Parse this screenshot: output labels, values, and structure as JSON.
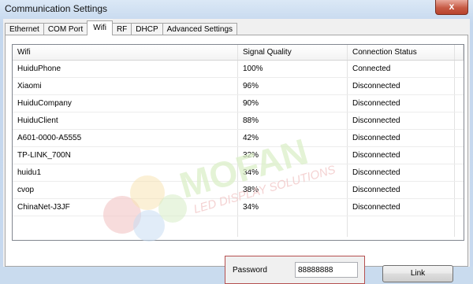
{
  "window": {
    "title": "Communication Settings",
    "close_glyph": "x"
  },
  "tabs": [
    {
      "label": "Ethernet",
      "active": false
    },
    {
      "label": "COM Port",
      "active": false
    },
    {
      "label": "Wifi",
      "active": true
    },
    {
      "label": "RF",
      "active": false
    },
    {
      "label": "DHCP",
      "active": false
    },
    {
      "label": "Advanced Settings",
      "active": false
    }
  ],
  "wifi_table": {
    "columns": [
      "Wifi",
      "Signal Quality",
      "Connection Status"
    ],
    "rows": [
      {
        "name": "HuiduPhone",
        "signal": "100%",
        "status": "Connected"
      },
      {
        "name": "Xiaomi",
        "signal": "96%",
        "status": "Disconnected"
      },
      {
        "name": "HuiduCompany",
        "signal": "90%",
        "status": "Disconnected"
      },
      {
        "name": "HuiduClient",
        "signal": "88%",
        "status": "Disconnected"
      },
      {
        "name": "A601-0000-A5555",
        "signal": "42%",
        "status": "Disconnected"
      },
      {
        "name": "TP-LINK_700N",
        "signal": "32%",
        "status": "Disconnected"
      },
      {
        "name": "huidu1",
        "signal": "34%",
        "status": "Disconnected"
      },
      {
        "name": "cvop",
        "signal": "38%",
        "status": "Disconnected"
      },
      {
        "name": "ChinaNet-J3JF",
        "signal": "34%",
        "status": "Disconnected"
      }
    ]
  },
  "password": {
    "label": "Password",
    "value": "88888888"
  },
  "link_button": {
    "label": "Link"
  },
  "watermark": {
    "brand": "MOFAN",
    "tagline": "LED DISPLAY SOLUTIONS"
  }
}
